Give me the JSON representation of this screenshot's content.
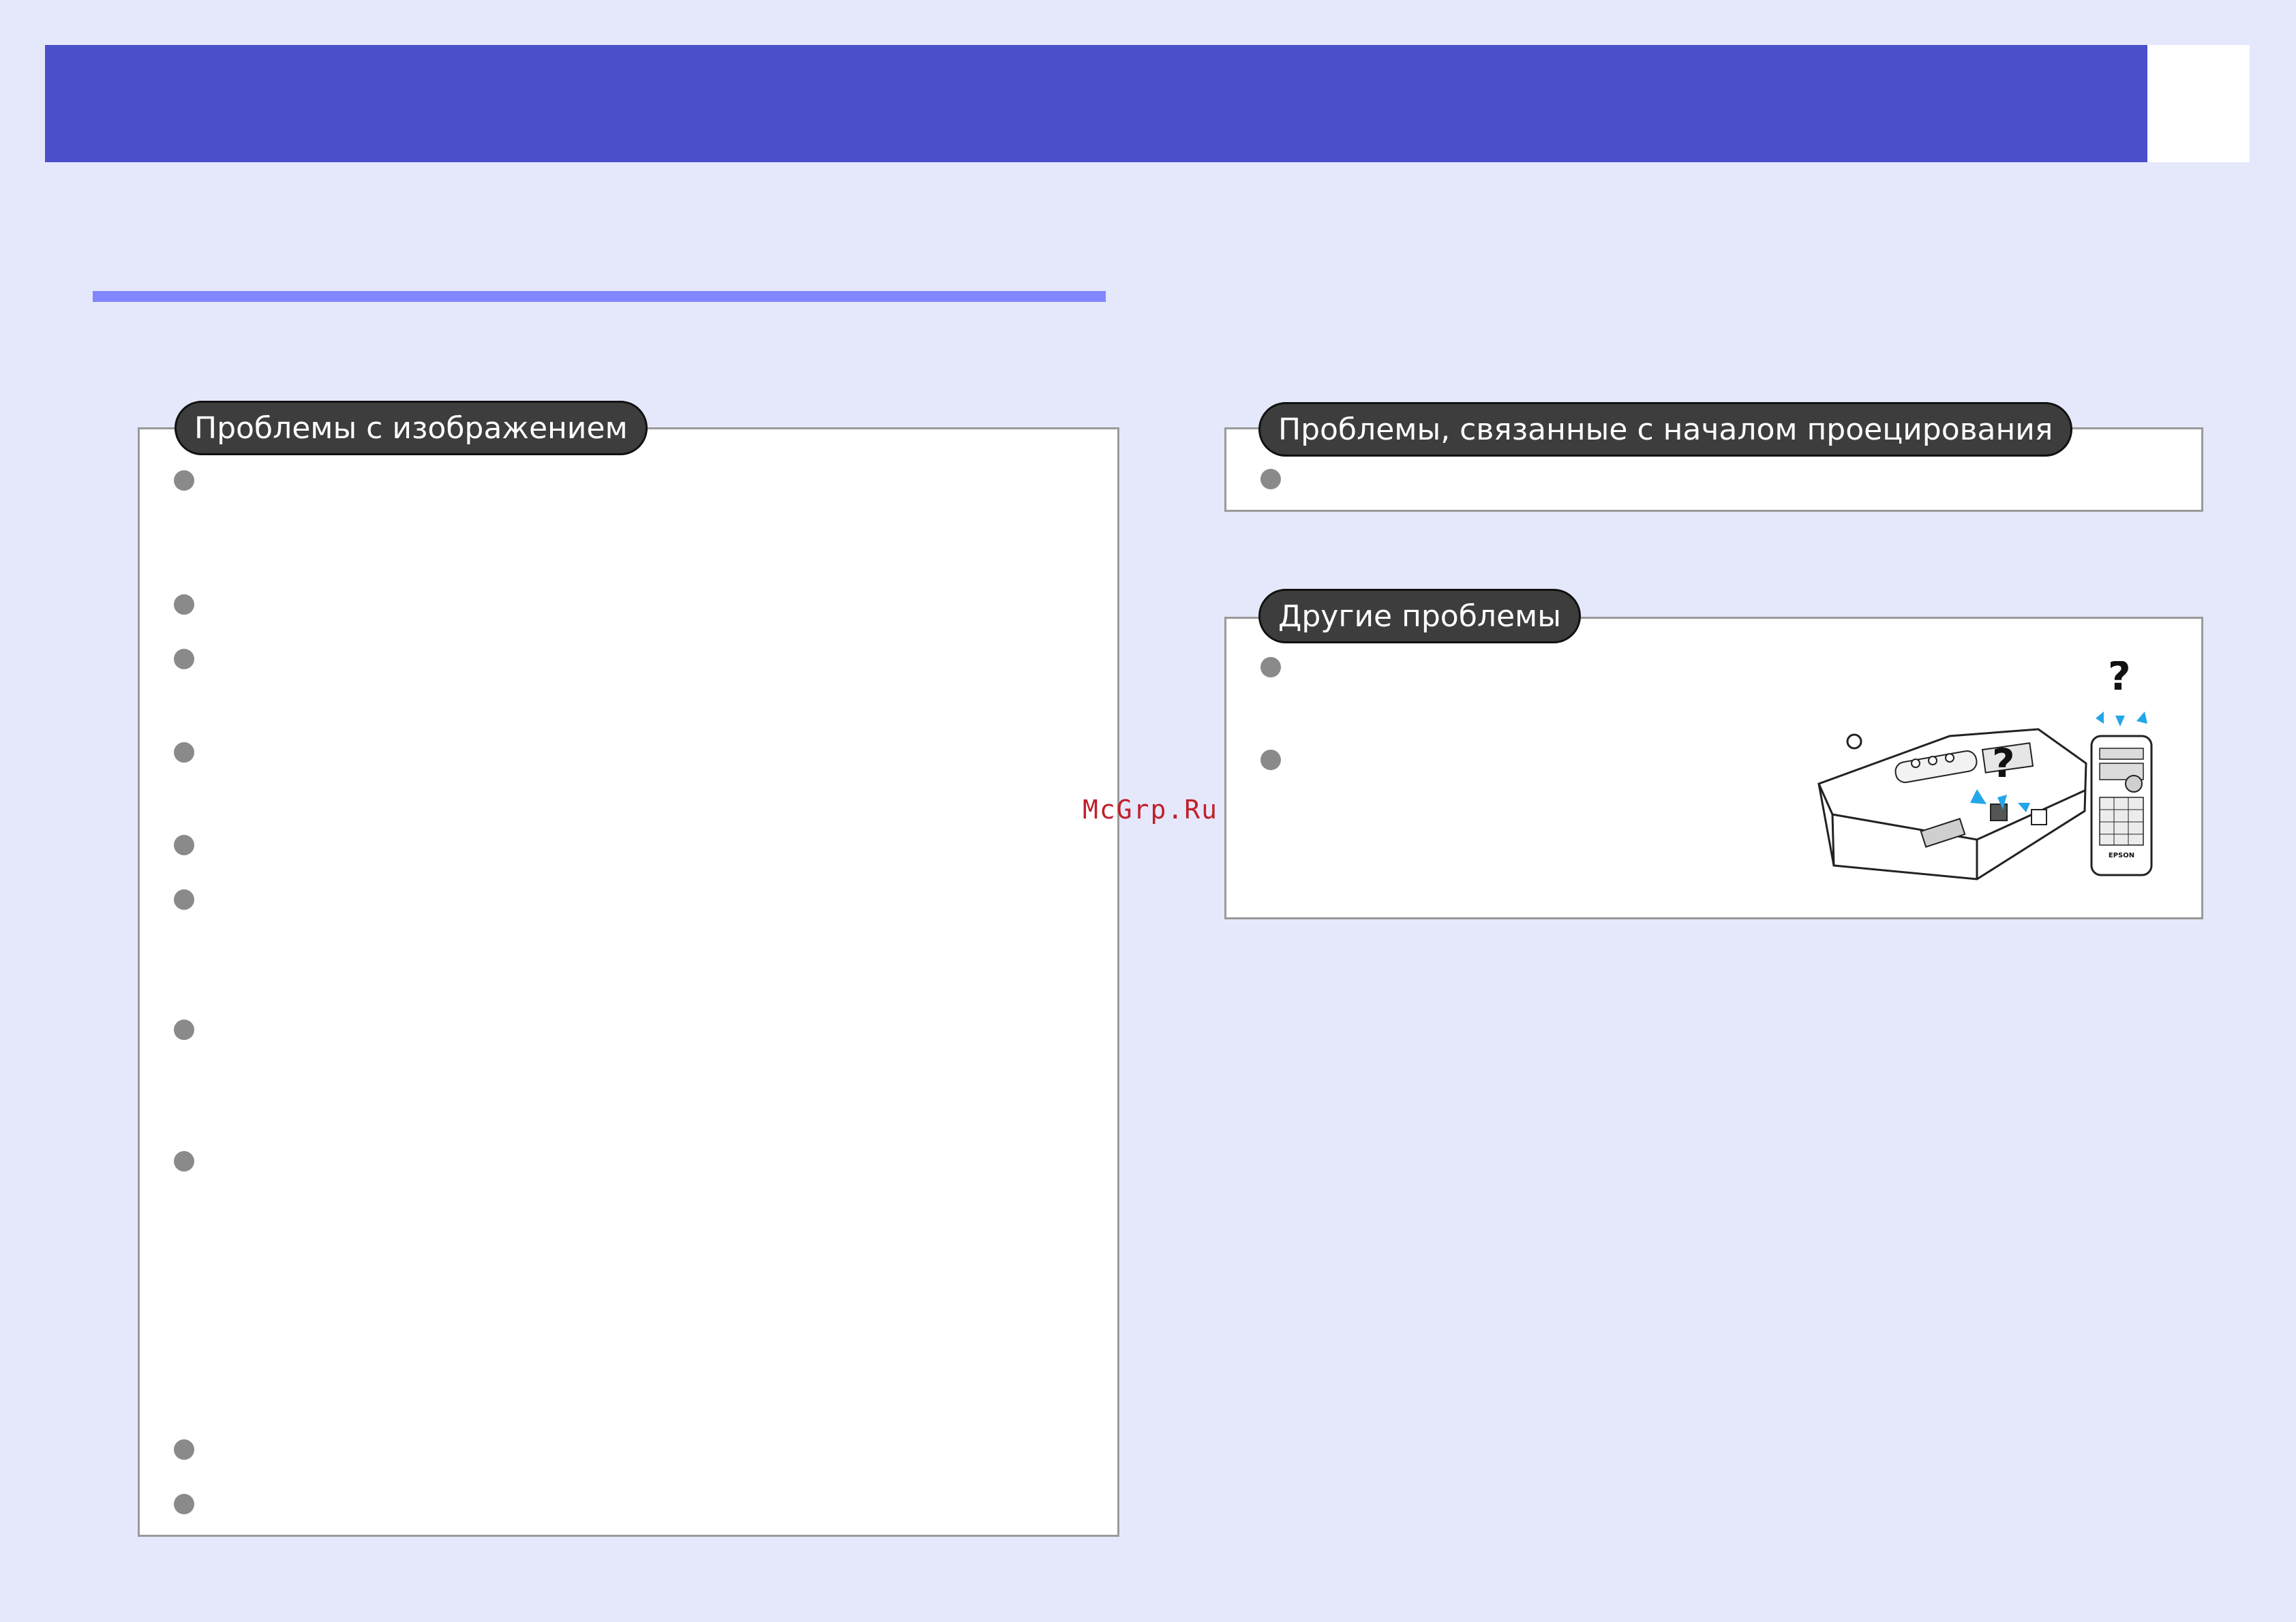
{
  "panels": {
    "image_problems": {
      "label": "Проблемы с изображением"
    },
    "projection_start": {
      "label": "Проблемы, связанные с началом проецирования"
    },
    "other_problems": {
      "label": "Другие проблемы"
    }
  },
  "watermark": "McGrp.Ru",
  "illustration": {
    "question_mark": "?",
    "remote_brand": "EPSON",
    "accent_color": "#23a6e8"
  }
}
